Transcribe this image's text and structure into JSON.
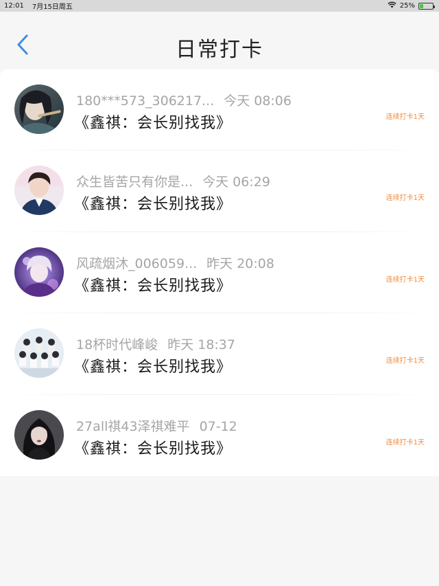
{
  "status_bar": {
    "time": "12:01",
    "date": "7月15日周五",
    "battery_text": "25%",
    "battery_level": 0.25,
    "wifi_icon": "wifi-icon",
    "battery_icon": "battery-charging-icon"
  },
  "header": {
    "title": "日常打卡",
    "back_icon": "chevron-left-icon",
    "accent_color": "#3a8ee6"
  },
  "checkins": [
    {
      "user": "180***573_306217...",
      "time": "今天 08:06",
      "book": "《鑫祺：会长别找我》",
      "streak": "连续打卡1天"
    },
    {
      "user": "众生皆苦只有你是...",
      "time": "今天 06:29",
      "book": "《鑫祺：会长别找我》",
      "streak": "连续打卡1天"
    },
    {
      "user": "风疏烟沐_006059...",
      "time": "昨天 20:08",
      "book": "《鑫祺：会长别找我》",
      "streak": "连续打卡1天"
    },
    {
      "user": "18杯时代峰峻",
      "time": "昨天 18:37",
      "book": "《鑫祺：会长别找我》",
      "streak": "连续打卡1天"
    },
    {
      "user": "27all祺43泽祺难平",
      "time": "07-12",
      "book": "《鑫祺：会长别找我》",
      "streak": "连续打卡1天"
    }
  ],
  "colors": {
    "streak": "#f08a3c",
    "meta_gray": "#a5a5a5",
    "background": "#f7f6f6"
  }
}
